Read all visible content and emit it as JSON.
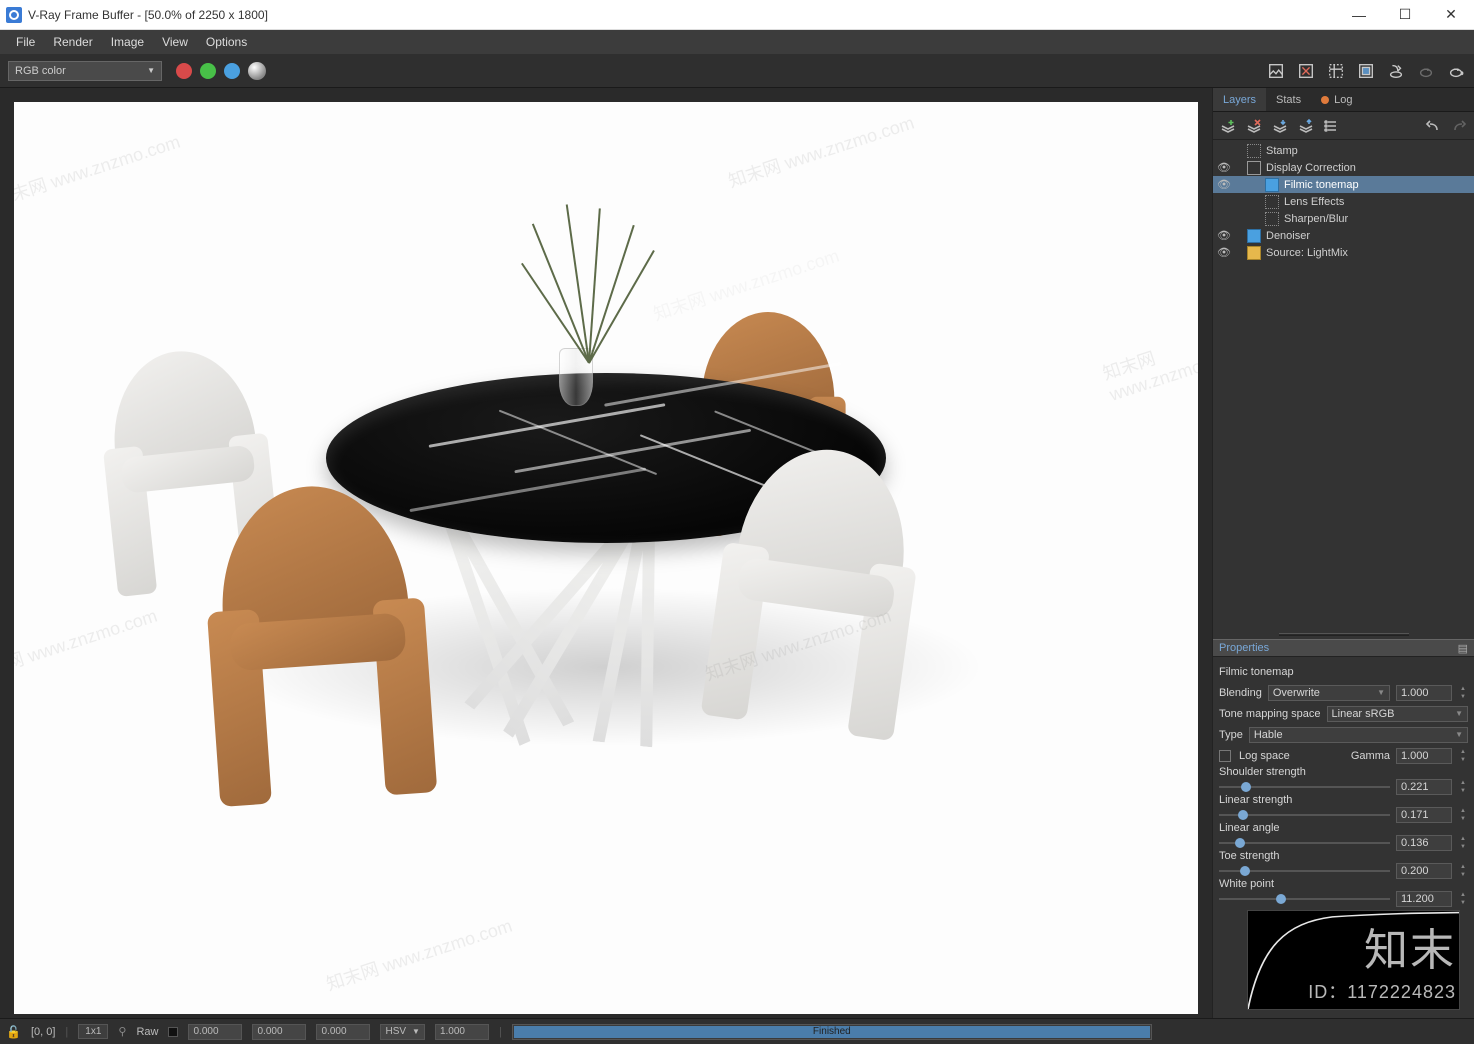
{
  "window": {
    "title": "V-Ray Frame Buffer - [50.0% of 2250 x 1800]"
  },
  "menu": {
    "items": [
      "File",
      "Render",
      "Image",
      "View",
      "Options"
    ]
  },
  "toolbar": {
    "channel_select": "RGB color",
    "dots": [
      "#d94a4a",
      "#48c048",
      "#4aa0e0"
    ]
  },
  "side_tabs": {
    "layers": "Layers",
    "stats": "Stats",
    "log": "Log"
  },
  "layers": [
    {
      "eye": "",
      "indent": 0,
      "icon": "boxd",
      "label": "Stamp"
    },
    {
      "eye": "👁",
      "indent": 0,
      "icon": "box",
      "label": "Display Correction"
    },
    {
      "eye": "👁",
      "indent": 1,
      "icon": "fill",
      "label": "Filmic tonemap",
      "selected": true
    },
    {
      "eye": "",
      "indent": 1,
      "icon": "boxd",
      "label": "Lens Effects"
    },
    {
      "eye": "",
      "indent": 1,
      "icon": "boxd",
      "label": "Sharpen/Blur"
    },
    {
      "eye": "👁",
      "indent": 0,
      "icon": "fill",
      "label": "Denoiser"
    },
    {
      "eye": "👁",
      "indent": 0,
      "icon": "src",
      "label": "Source: LightMix"
    }
  ],
  "properties": {
    "title": "Properties",
    "name": "Filmic tonemap",
    "blending_label": "Blending",
    "blending_value": "Overwrite",
    "blending_amount": "1.000",
    "tms_label": "Tone mapping space",
    "tms_value": "Linear sRGB",
    "type_label": "Type",
    "type_value": "Hable",
    "log_space": "Log space",
    "gamma_label": "Gamma",
    "gamma_value": "1.000",
    "sliders": [
      {
        "label": "Shoulder strength",
        "value": "0.221",
        "pct": 16
      },
      {
        "label": "Linear strength",
        "value": "0.171",
        "pct": 14
      },
      {
        "label": "Linear angle",
        "value": "0.136",
        "pct": 12
      },
      {
        "label": "Toe strength",
        "value": "0.200",
        "pct": 15
      },
      {
        "label": "White point",
        "value": "11.200",
        "pct": 36
      }
    ]
  },
  "status": {
    "coords": "[0, 0]",
    "region": "1x1",
    "raw": "Raw",
    "vals": [
      "0.000",
      "0.000",
      "0.000"
    ],
    "space": "HSV",
    "alpha": "1.000",
    "progress": "Finished"
  },
  "watermark": {
    "brand_cn": "知末",
    "brand_id": "ID：1172224823",
    "diag": "知末网 www.znzmo.com"
  }
}
